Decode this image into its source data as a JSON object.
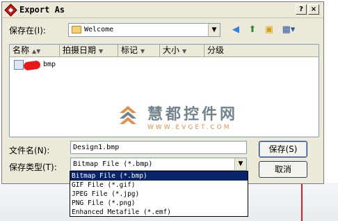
{
  "window": {
    "title": "Export As",
    "help_label": "?",
    "close_label": "×"
  },
  "save_in": {
    "label": "保存在(I):",
    "value": "Welcome",
    "icons": [
      "back-icon",
      "up-folder-icon",
      "new-folder-icon",
      "view-menu-icon"
    ]
  },
  "columns": [
    {
      "label": "名称"
    },
    {
      "label": "拍摄日期"
    },
    {
      "label": "标记"
    },
    {
      "label": "大小"
    },
    {
      "label": "分级"
    }
  ],
  "files": [
    {
      "name": "bmp"
    }
  ],
  "watermark": {
    "text": "慧都控件网",
    "url": "WWW.EVGET.COM"
  },
  "filename": {
    "label": "文件名(N):",
    "value": "Design1.bmp"
  },
  "filetype": {
    "label": "保存类型(T):",
    "value": "Bitmap File (*.bmp)",
    "options": [
      "Bitmap File (*.bmp)",
      "GIF File (*.gif)",
      "JPEG File (*.jpg)",
      "PNG File (*.png)",
      "Enhanced Metafile (*.emf)"
    ],
    "selected_index": 0
  },
  "buttons": {
    "save": "保存(S)",
    "cancel": "取消"
  },
  "colors": {
    "dialog_bg": "#ece9d8",
    "selection": "#0a246a",
    "accent_red": "#e02020"
  }
}
